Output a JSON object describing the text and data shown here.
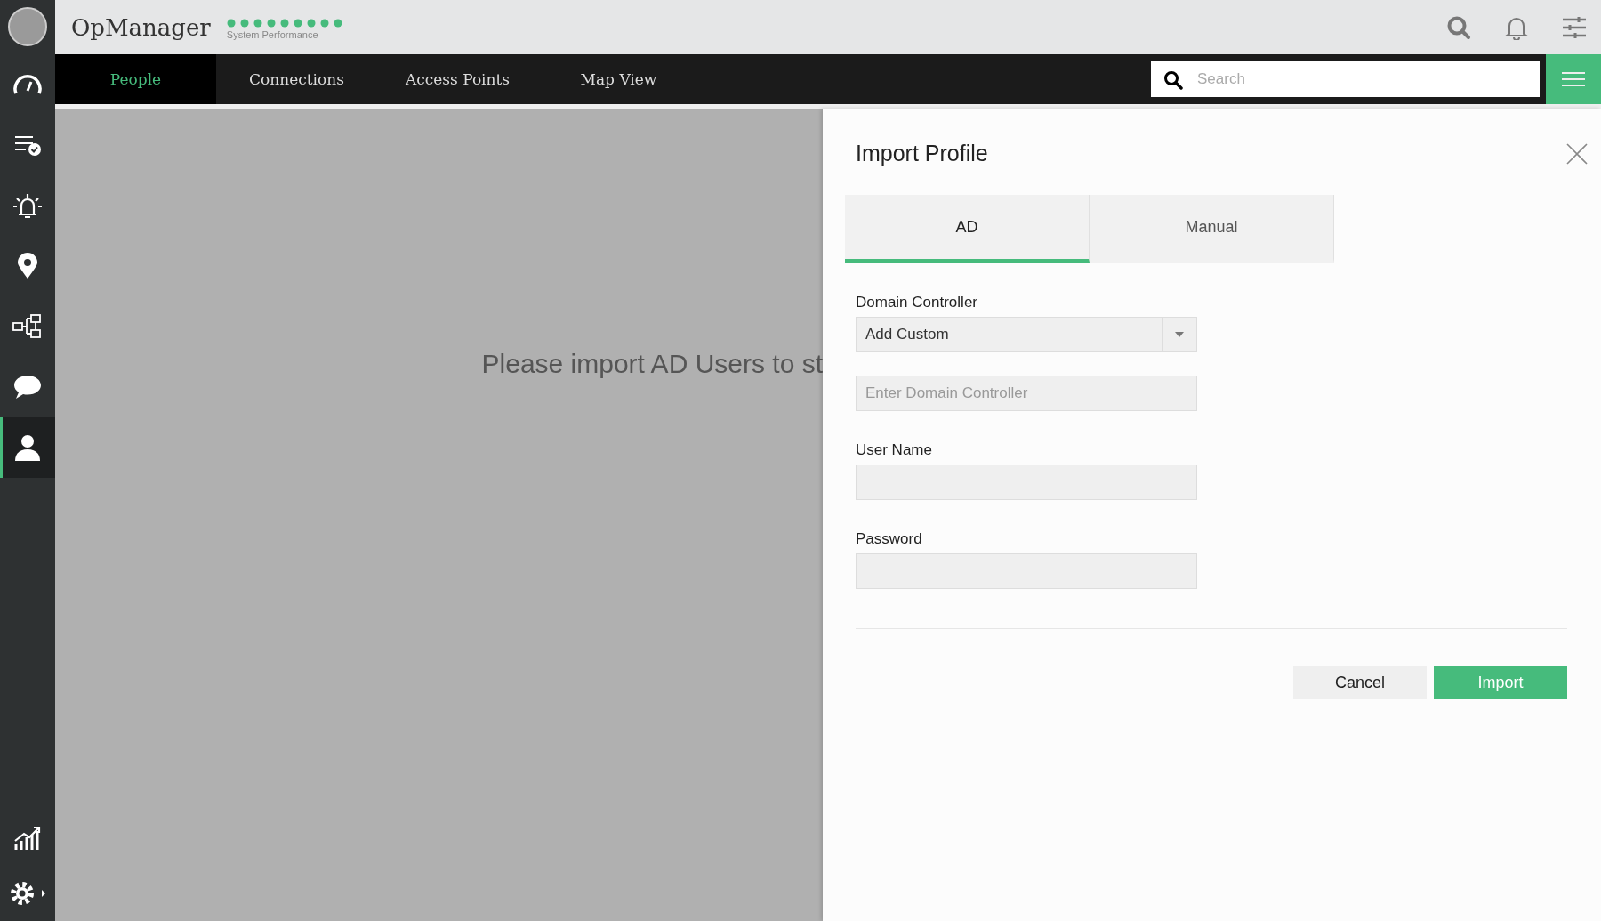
{
  "header": {
    "app_name": "OpManager",
    "status_caption": "System Performance"
  },
  "sidebar": {
    "items": [
      {
        "kind": "gauge",
        "selected": false
      },
      {
        "kind": "checklist",
        "selected": false
      },
      {
        "kind": "alarm",
        "selected": false
      },
      {
        "kind": "pin",
        "selected": false
      },
      {
        "kind": "flow",
        "selected": false
      },
      {
        "kind": "chat",
        "selected": false
      },
      {
        "kind": "person",
        "selected": true
      }
    ],
    "bottom_items": [
      {
        "kind": "chart"
      },
      {
        "kind": "gear"
      }
    ]
  },
  "nav": {
    "tabs": [
      {
        "label": "People",
        "selected": true
      },
      {
        "label": "Connections",
        "selected": false
      },
      {
        "label": "Access Points",
        "selected": false
      },
      {
        "label": "Map View",
        "selected": false
      }
    ],
    "search": {
      "placeholder": "Search"
    }
  },
  "content": {
    "message": "Please import AD Users to st"
  },
  "panel": {
    "title": "Import Profile",
    "tabs": [
      {
        "label": "AD",
        "selected": true
      },
      {
        "label": "Manual",
        "selected": false
      }
    ],
    "fields": [
      {
        "kind": "select",
        "label": "Domain Controller",
        "value": "Add Custom"
      },
      {
        "kind": "text",
        "placeholder": "Enter Domain Controller"
      },
      {
        "kind": "text",
        "label": "User Name"
      },
      {
        "kind": "password",
        "label": "Password"
      }
    ],
    "buttons": [
      {
        "label": "Cancel",
        "kind": "secondary"
      },
      {
        "label": "Import",
        "kind": "primary"
      }
    ]
  }
}
